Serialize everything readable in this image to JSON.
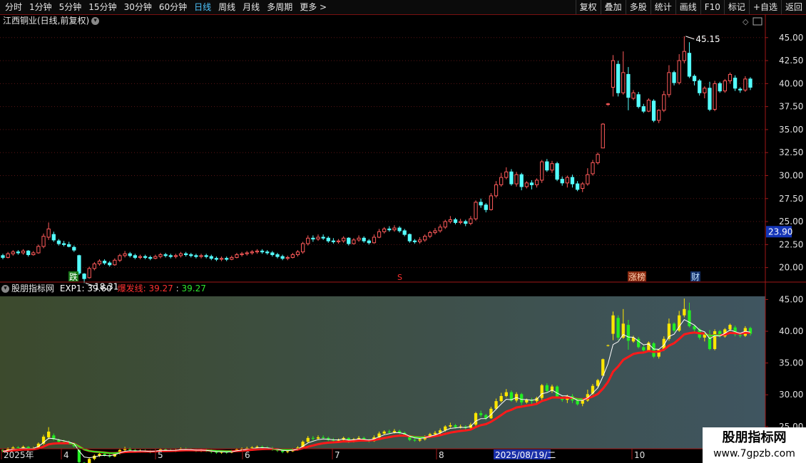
{
  "toolbar": {
    "left": [
      "分时",
      "1分钟",
      "5分钟",
      "15分钟",
      "30分钟",
      "60分钟",
      "日线",
      "周线",
      "月线",
      "多周期",
      "更多 >"
    ],
    "active": "日线",
    "right": [
      "复权",
      "叠加",
      "多股",
      "统计",
      "画线",
      "F10",
      "标记",
      "+自选",
      "返回"
    ]
  },
  "main_title": "江西铜业(日线,前复权)",
  "price_axis": {
    "ticks": [
      "45.00",
      "42.50",
      "40.00",
      "37.50",
      "35.00",
      "32.50",
      "30.00",
      "27.50",
      "25.00",
      "22.50",
      "20.00"
    ],
    "current_price": "23.90"
  },
  "annotations": {
    "high_label": "45.15",
    "low_label": "18.31",
    "badge_drop": "跌",
    "badge_s": "S",
    "badge_zhangbang": "涨榜",
    "badge_cai": "财"
  },
  "indicator": {
    "name": "股朋指标网",
    "exp1_label": "EXP1:",
    "exp1_value": "39.60",
    "burst_label": "爆发线:",
    "burst_value1": "39.27",
    "burst_value2": "39.27",
    "ticks": [
      "45.00",
      "40.00",
      "35.00",
      "30.00",
      "25.00"
    ]
  },
  "date_axis": {
    "labels": [
      "2025年",
      "4",
      "5",
      "6",
      "7",
      "8",
      "10"
    ],
    "cursor_date": "2025/08/19/二"
  },
  "watermark": {
    "line1": "股朋指标网",
    "line2": "www.7gpzb.com"
  },
  "colors": {
    "up": "#ff5a5a",
    "down": "#54ffff",
    "ma_white": "#ffffff",
    "burst_red": "#ff1a1a",
    "yellow": "#ffe600",
    "green": "#22ee22",
    "axis_red": "#a01818"
  },
  "chart_data": {
    "type": "candlestick",
    "ylim_main": [
      18.5,
      46.3
    ],
    "ylim_indicator": [
      21.5,
      45.5
    ],
    "candles": [
      [
        21.3,
        21.1,
        21.5,
        20.9
      ],
      [
        21.1,
        21.5,
        21.7,
        21.0
      ],
      [
        21.5,
        21.7,
        21.9,
        21.3
      ],
      [
        21.7,
        21.6,
        21.9,
        21.4
      ],
      [
        21.6,
        21.8,
        22.0,
        21.4
      ],
      [
        21.8,
        21.4,
        21.9,
        21.2
      ],
      [
        21.4,
        21.6,
        21.8,
        21.3
      ],
      [
        21.6,
        22.3,
        22.5,
        21.5
      ],
      [
        22.3,
        23.4,
        23.7,
        22.1
      ],
      [
        23.3,
        24.2,
        24.9,
        23.0
      ],
      [
        23.6,
        23.0,
        23.9,
        22.8
      ],
      [
        22.9,
        22.6,
        23.1,
        22.4
      ],
      [
        22.6,
        22.5,
        22.9,
        22.3
      ],
      [
        22.5,
        22.3,
        22.8,
        22.2
      ],
      [
        22.2,
        21.9,
        22.4,
        21.7
      ],
      [
        21.3,
        19.4,
        21.4,
        19.2
      ],
      [
        19.3,
        18.8,
        19.4,
        18.31
      ],
      [
        18.9,
        19.9,
        20.1,
        18.8
      ],
      [
        19.9,
        20.4,
        20.6,
        19.7
      ],
      [
        20.4,
        20.7,
        20.9,
        20.2
      ],
      [
        20.7,
        20.5,
        20.9,
        20.3
      ],
      [
        20.5,
        20.3,
        20.7,
        20.1
      ],
      [
        20.3,
        20.8,
        21.0,
        20.2
      ],
      [
        20.8,
        21.3,
        21.5,
        20.6
      ],
      [
        21.3,
        21.5,
        21.8,
        21.1
      ],
      [
        21.5,
        21.3,
        21.7,
        21.1
      ],
      [
        21.3,
        21.1,
        21.5,
        20.9
      ],
      [
        21.1,
        21.2,
        21.4,
        20.9
      ],
      [
        21.2,
        21.1,
        21.4,
        20.9
      ],
      [
        21.1,
        21.0,
        21.3,
        20.8
      ],
      [
        21.0,
        21.2,
        21.4,
        20.9
      ],
      [
        21.2,
        21.4,
        21.6,
        21.0
      ],
      [
        21.4,
        21.3,
        21.6,
        21.1
      ],
      [
        21.3,
        21.2,
        21.5,
        21.0
      ],
      [
        21.2,
        21.3,
        21.5,
        21.0
      ],
      [
        21.3,
        21.5,
        21.7,
        21.1
      ],
      [
        21.5,
        21.4,
        21.7,
        21.2
      ],
      [
        21.4,
        21.3,
        21.6,
        21.1
      ],
      [
        21.3,
        21.2,
        21.5,
        21.0
      ],
      [
        21.2,
        21.3,
        21.5,
        21.0
      ],
      [
        21.3,
        21.2,
        21.5,
        21.0
      ],
      [
        21.2,
        21.0,
        21.4,
        20.8
      ],
      [
        21.0,
        20.9,
        21.2,
        20.7
      ],
      [
        20.9,
        21.0,
        21.2,
        20.7
      ],
      [
        21.0,
        20.9,
        21.2,
        20.7
      ],
      [
        20.9,
        21.1,
        21.3,
        20.8
      ],
      [
        21.1,
        21.4,
        21.6,
        21.0
      ],
      [
        21.4,
        21.5,
        21.7,
        21.2
      ],
      [
        21.5,
        21.6,
        21.8,
        21.3
      ],
      [
        21.6,
        21.7,
        21.9,
        21.4
      ],
      [
        21.7,
        21.8,
        22.0,
        21.5
      ],
      [
        21.8,
        21.7,
        22.0,
        21.5
      ],
      [
        21.7,
        21.6,
        21.9,
        21.4
      ],
      [
        21.6,
        21.4,
        21.8,
        21.2
      ],
      [
        21.4,
        21.2,
        21.6,
        21.0
      ],
      [
        21.2,
        21.0,
        21.4,
        20.8
      ],
      [
        21.0,
        21.1,
        21.3,
        20.8
      ],
      [
        21.1,
        21.4,
        21.6,
        21.0
      ],
      [
        21.4,
        21.7,
        21.9,
        21.2
      ],
      [
        21.7,
        22.6,
        22.8,
        21.5
      ],
      [
        22.6,
        23.2,
        23.5,
        22.4
      ],
      [
        23.2,
        23.1,
        23.5,
        22.8
      ],
      [
        23.1,
        23.3,
        23.6,
        22.9
      ],
      [
        23.3,
        23.2,
        23.6,
        23.0
      ],
      [
        23.2,
        22.9,
        23.4,
        22.7
      ],
      [
        22.9,
        22.8,
        23.2,
        22.6
      ],
      [
        22.8,
        22.9,
        23.1,
        22.6
      ],
      [
        22.9,
        23.2,
        23.4,
        22.7
      ],
      [
        23.2,
        22.6,
        23.3,
        22.4
      ],
      [
        22.6,
        23.0,
        23.2,
        22.5
      ],
      [
        23.0,
        23.2,
        23.5,
        22.8
      ],
      [
        23.2,
        22.9,
        23.4,
        22.7
      ],
      [
        22.9,
        22.7,
        23.1,
        22.5
      ],
      [
        22.7,
        23.3,
        23.6,
        22.6
      ],
      [
        23.3,
        23.9,
        24.2,
        23.2
      ],
      [
        23.9,
        24.2,
        24.4,
        23.7
      ],
      [
        24.2,
        24.1,
        24.5,
        23.9
      ],
      [
        24.1,
        24.3,
        24.6,
        23.9
      ],
      [
        24.3,
        24.0,
        24.5,
        23.8
      ],
      [
        24.0,
        23.6,
        24.2,
        23.4
      ],
      [
        23.6,
        22.9,
        23.7,
        22.7
      ],
      [
        22.9,
        22.8,
        23.1,
        22.6
      ],
      [
        22.8,
        23.0,
        23.3,
        22.6
      ],
      [
        23.0,
        23.4,
        23.6,
        22.8
      ],
      [
        23.4,
        23.8,
        24.0,
        23.2
      ],
      [
        23.8,
        24.0,
        24.3,
        23.6
      ],
      [
        24.0,
        24.4,
        24.7,
        23.8
      ],
      [
        24.4,
        25.0,
        25.2,
        24.2
      ],
      [
        25.0,
        25.2,
        25.6,
        24.8
      ],
      [
        25.2,
        24.9,
        25.4,
        24.7
      ],
      [
        24.9,
        25.0,
        25.3,
        24.7
      ],
      [
        25.0,
        24.8,
        25.2,
        24.5
      ],
      [
        24.8,
        25.3,
        25.6,
        24.6
      ],
      [
        25.3,
        27.1,
        27.3,
        25.1
      ],
      [
        27.1,
        26.8,
        27.5,
        26.5
      ],
      [
        26.8,
        26.3,
        27.0,
        26.0
      ],
      [
        26.3,
        27.8,
        28.1,
        26.2
      ],
      [
        27.8,
        29.0,
        29.4,
        27.6
      ],
      [
        29.0,
        29.8,
        30.3,
        28.8
      ],
      [
        29.8,
        30.4,
        30.9,
        29.6
      ],
      [
        30.4,
        29.1,
        30.7,
        28.9
      ],
      [
        29.1,
        30.1,
        30.4,
        28.8
      ],
      [
        30.1,
        28.8,
        30.3,
        28.4
      ],
      [
        28.8,
        29.2,
        29.4,
        28.6
      ],
      [
        29.2,
        29.0,
        29.5,
        28.5
      ],
      [
        29.0,
        29.5,
        29.7,
        28.7
      ],
      [
        29.5,
        31.5,
        31.7,
        29.2
      ],
      [
        31.5,
        30.6,
        31.8,
        30.4
      ],
      [
        30.6,
        31.3,
        31.6,
        30.3
      ],
      [
        31.3,
        29.6,
        31.5,
        29.4
      ],
      [
        29.6,
        29.2,
        29.9,
        28.9
      ],
      [
        29.2,
        29.8,
        30.0,
        28.7
      ],
      [
        29.8,
        29.1,
        30.1,
        28.7
      ],
      [
        29.1,
        28.5,
        29.4,
        28.3
      ],
      [
        28.6,
        29.1,
        29.3,
        28.2
      ],
      [
        29.1,
        30.1,
        30.8,
        28.9
      ],
      [
        30.2,
        31.4,
        31.7,
        30.0
      ],
      [
        31.4,
        32.3,
        32.5,
        31.2
      ],
      [
        33.0,
        35.6,
        35.7,
        33.0
      ],
      [
        37.8,
        37.8,
        37.9,
        37.6
      ],
      [
        39.6,
        42.5,
        43.1,
        38.6
      ],
      [
        42.1,
        39.0,
        42.5,
        38.6
      ],
      [
        39.0,
        41.2,
        43.5,
        38.8
      ],
      [
        41.0,
        38.5,
        41.8,
        37.1
      ],
      [
        38.4,
        39.0,
        39.3,
        38.2
      ],
      [
        38.8,
        37.5,
        39.1,
        37.3
      ],
      [
        37.5,
        37.0,
        37.8,
        36.8
      ],
      [
        37.0,
        38.2,
        38.4,
        36.9
      ],
      [
        38.1,
        36.0,
        38.3,
        35.8
      ],
      [
        36.0,
        37.1,
        37.2,
        35.7
      ],
      [
        37.1,
        38.8,
        39.2,
        36.9
      ],
      [
        38.8,
        41.2,
        42.0,
        38.5
      ],
      [
        41.2,
        40.1,
        41.4,
        39.8
      ],
      [
        40.1,
        42.5,
        43.2,
        39.9
      ],
      [
        42.5,
        43.5,
        45.15,
        42.2
      ],
      [
        43.3,
        40.8,
        44.5,
        40.6
      ],
      [
        40.8,
        40.3,
        41.0,
        39.8
      ],
      [
        40.3,
        39.0,
        40.5,
        38.7
      ],
      [
        39.0,
        39.5,
        39.7,
        38.4
      ],
      [
        39.5,
        37.2,
        40.2,
        37.0
      ],
      [
        37.2,
        40.0,
        40.3,
        37.0
      ],
      [
        40.0,
        39.2,
        40.2,
        39.0
      ],
      [
        39.2,
        40.3,
        40.5,
        39.0
      ],
      [
        40.3,
        41.0,
        41.2,
        40.0
      ],
      [
        40.6,
        39.5,
        40.9,
        39.2
      ],
      [
        39.4,
        39.3,
        39.6,
        39.0
      ],
      [
        39.3,
        40.5,
        40.8,
        39.1
      ],
      [
        40.5,
        39.6,
        40.7,
        39.3
      ]
    ]
  }
}
